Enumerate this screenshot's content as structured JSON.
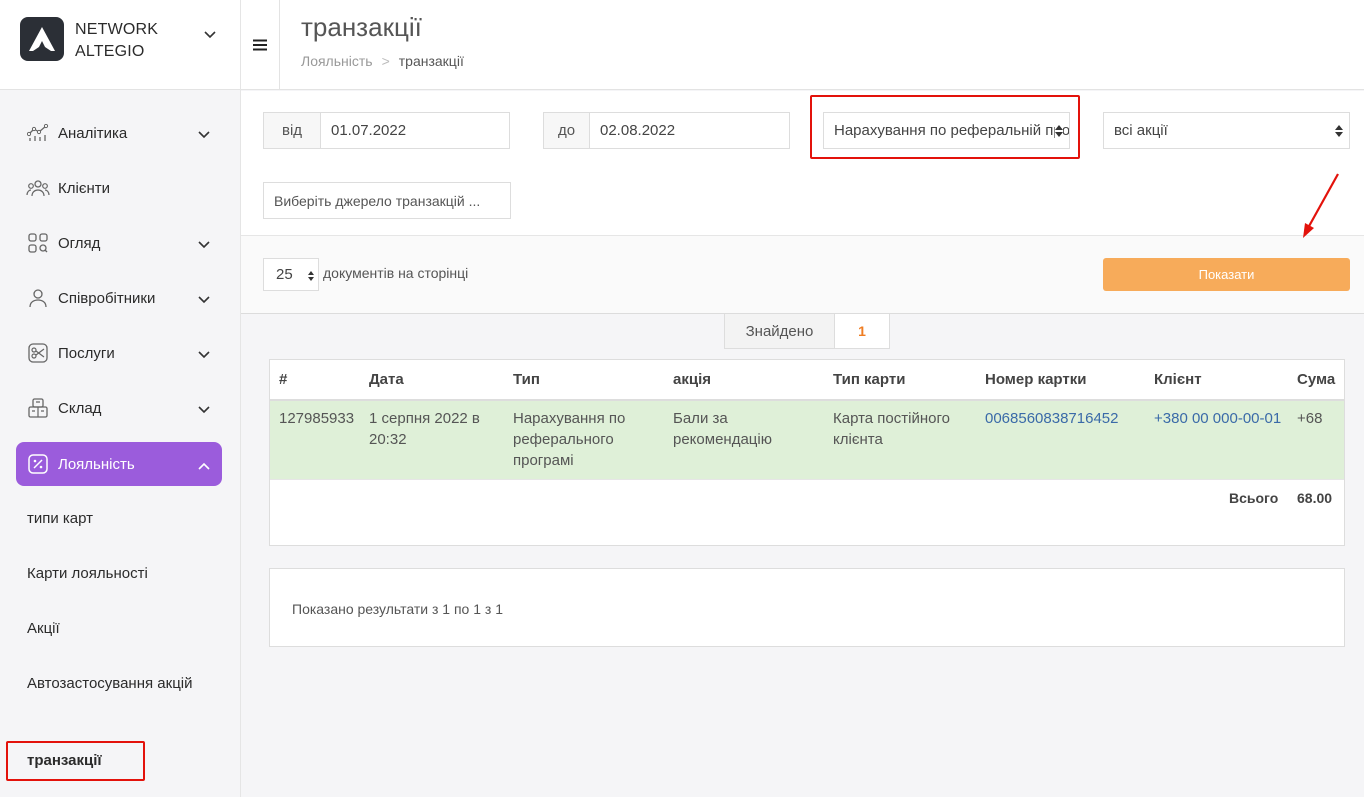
{
  "brand": {
    "line1": "NETWORK",
    "line2": "ALTEGIO"
  },
  "sidebar": {
    "items": [
      {
        "label": "Аналітика",
        "icon": "analytics-icon"
      },
      {
        "label": "Клієнти",
        "icon": "clients-icon"
      },
      {
        "label": "Огляд",
        "icon": "overview-icon"
      },
      {
        "label": "Співробітники",
        "icon": "staff-icon"
      },
      {
        "label": "Послуги",
        "icon": "services-icon"
      },
      {
        "label": "Склад",
        "icon": "warehouse-icon"
      },
      {
        "label": "Лояльність",
        "icon": "loyalty-icon"
      }
    ],
    "sub_items": [
      "типи карт",
      "Карти лояльності",
      "Акції",
      "Автозастосування акцій",
      "транзакції"
    ]
  },
  "header": {
    "title": "транзакції",
    "breadcrumb": {
      "parent": "Лояльність",
      "separator": ">",
      "current": "транзакції"
    }
  },
  "filters": {
    "from_label": "від",
    "from_value": "01.07.2022",
    "to_label": "до",
    "to_value": "02.08.2022",
    "type_value": "Нарахування по реферальній програмі",
    "promo_value": "всі акції",
    "source_placeholder": "Виберіть джерело транзакцій ..."
  },
  "toolbar": {
    "per_page": "25",
    "per_page_label": "документів на сторінці",
    "show_button": "Показати"
  },
  "found": {
    "label": "Знайдено",
    "count": "1"
  },
  "table": {
    "columns": [
      "#",
      "Дата",
      "Тип",
      "акція",
      "Тип карти",
      "Номер картки",
      "Клієнт",
      "Сума"
    ],
    "rows": [
      {
        "id": "127985933",
        "date": "1 серпня 2022 в 20:32",
        "type": "Нарахування по реферального програмі",
        "promo": "Бали за рекомендацію",
        "card_type": "Карта постійного клієнта",
        "card_number": "0068560838716452",
        "client": "+380 00 000-00-01",
        "sum": "+68"
      }
    ],
    "total_label": "Всього",
    "total_value": "68.00"
  },
  "results_text": "Показано результати з 1 по 1 з 1",
  "colors": {
    "accent": "#9b5cdc",
    "button": "#f7ab5a",
    "highlight": "#e3120b",
    "row": "#dff0d8"
  }
}
